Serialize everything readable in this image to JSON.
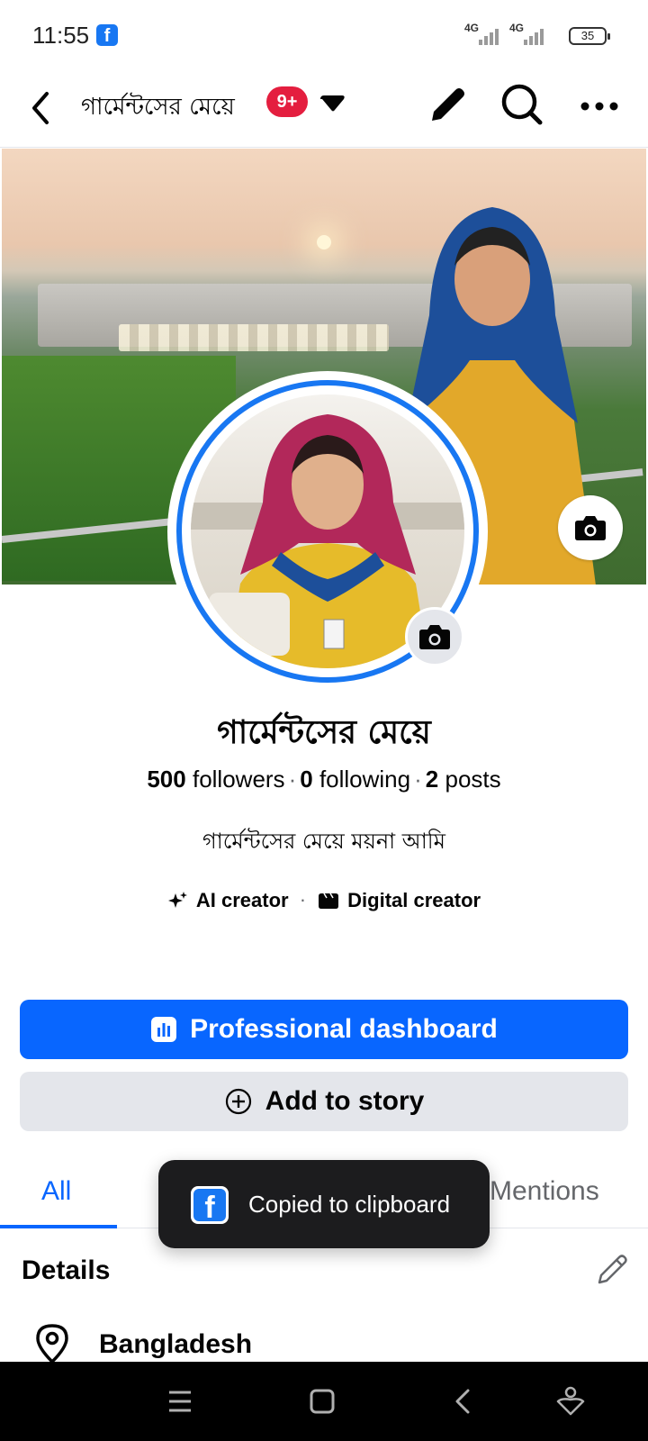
{
  "status_bar": {
    "time": "11:55",
    "network_1": "4G",
    "network_2": "4G",
    "battery": "35"
  },
  "header": {
    "title": "গার্মেন্টসের মেয়ে",
    "notification_badge": "9+"
  },
  "profile": {
    "name": "গার্মেন্টসের মেয়ে",
    "followers_count": "500",
    "followers_label": "followers",
    "following_count": "0",
    "following_label": "following",
    "posts_count": "2",
    "posts_label": "posts",
    "bio": "গার্মেন্টসের মেয়ে ময়না আমি",
    "categories": [
      "AI creator",
      "Digital creator"
    ]
  },
  "actions": {
    "primary_label": "Professional dashboard",
    "secondary_label": "Add to story"
  },
  "tabs": {
    "all": "All",
    "mentions": "Mentions"
  },
  "details": {
    "title": "Details",
    "location": "Bangladesh"
  },
  "toast": {
    "message": "Copied to clipboard"
  },
  "colors": {
    "brand_blue": "#0866ff",
    "badge_red": "#e41e3f"
  }
}
